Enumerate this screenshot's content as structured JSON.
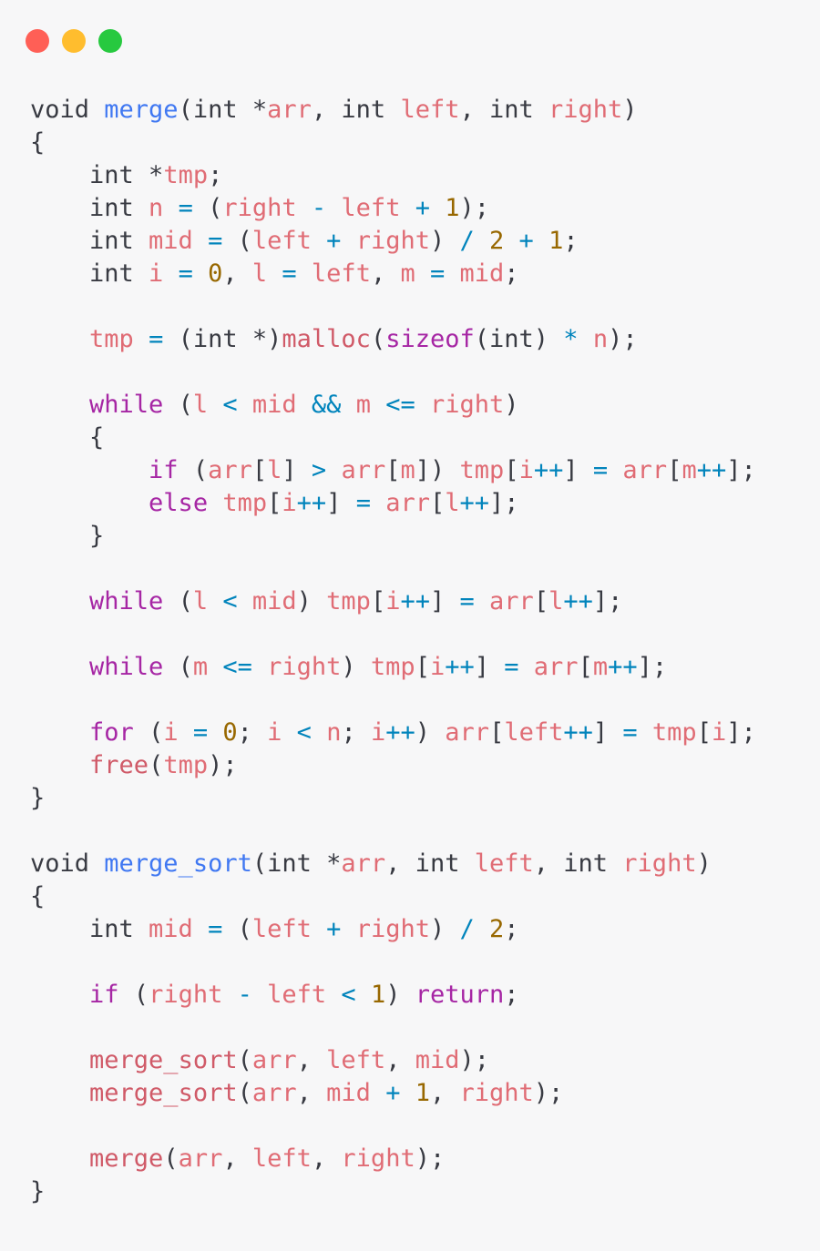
{
  "window_controls": {
    "close_color": "#ff5f56",
    "minimize_color": "#ffbd2e",
    "maximize_color": "#27c93f"
  },
  "code": {
    "language": "c",
    "colors": {
      "plain": "#383a42",
      "function_name": "#4078f2",
      "variable": "#e06c75",
      "number": "#986801",
      "operator": "#0184bc",
      "keyword": "#a626a4"
    },
    "lines": [
      [
        [
          "t",
          "void "
        ],
        [
          "f",
          "merge"
        ],
        [
          "t",
          "(int *"
        ],
        [
          "v",
          "arr"
        ],
        [
          "t",
          ", int "
        ],
        [
          "v",
          "left"
        ],
        [
          "t",
          ", int "
        ],
        [
          "v",
          "right"
        ],
        [
          "t",
          ")"
        ]
      ],
      [
        [
          "t",
          "{"
        ]
      ],
      [
        [
          "t",
          "    int *"
        ],
        [
          "v",
          "tmp"
        ],
        [
          "t",
          ";"
        ]
      ],
      [
        [
          "t",
          "    int "
        ],
        [
          "v",
          "n"
        ],
        [
          "o",
          " = "
        ],
        [
          "t",
          "("
        ],
        [
          "v",
          "right"
        ],
        [
          "o",
          " - "
        ],
        [
          "v",
          "left"
        ],
        [
          "o",
          " + "
        ],
        [
          "n",
          "1"
        ],
        [
          "t",
          ");"
        ]
      ],
      [
        [
          "t",
          "    int "
        ],
        [
          "v",
          "mid"
        ],
        [
          "o",
          " = "
        ],
        [
          "t",
          "("
        ],
        [
          "v",
          "left"
        ],
        [
          "o",
          " + "
        ],
        [
          "v",
          "right"
        ],
        [
          "t",
          ")"
        ],
        [
          "o",
          " / "
        ],
        [
          "n",
          "2"
        ],
        [
          "o",
          " + "
        ],
        [
          "n",
          "1"
        ],
        [
          "t",
          ";"
        ]
      ],
      [
        [
          "t",
          "    int "
        ],
        [
          "v",
          "i"
        ],
        [
          "o",
          " = "
        ],
        [
          "n",
          "0"
        ],
        [
          "t",
          ", "
        ],
        [
          "v",
          "l"
        ],
        [
          "o",
          " = "
        ],
        [
          "v",
          "left"
        ],
        [
          "t",
          ", "
        ],
        [
          "v",
          "m"
        ],
        [
          "o",
          " = "
        ],
        [
          "v",
          "mid"
        ],
        [
          "t",
          ";"
        ]
      ],
      [],
      [
        [
          "t",
          "    "
        ],
        [
          "v",
          "tmp"
        ],
        [
          "o",
          " = "
        ],
        [
          "t",
          "(int *)"
        ],
        [
          "c",
          "malloc"
        ],
        [
          "t",
          "("
        ],
        [
          "k",
          "sizeof"
        ],
        [
          "t",
          "(int)"
        ],
        [
          "o",
          " * "
        ],
        [
          "v",
          "n"
        ],
        [
          "t",
          ");"
        ]
      ],
      [],
      [
        [
          "t",
          "    "
        ],
        [
          "k",
          "while"
        ],
        [
          "t",
          " ("
        ],
        [
          "v",
          "l"
        ],
        [
          "o",
          " < "
        ],
        [
          "v",
          "mid"
        ],
        [
          "o",
          " && "
        ],
        [
          "v",
          "m"
        ],
        [
          "o",
          " <= "
        ],
        [
          "v",
          "right"
        ],
        [
          "t",
          ")"
        ]
      ],
      [
        [
          "t",
          "    {"
        ]
      ],
      [
        [
          "t",
          "        "
        ],
        [
          "k",
          "if"
        ],
        [
          "t",
          " ("
        ],
        [
          "v",
          "arr"
        ],
        [
          "t",
          "["
        ],
        [
          "v",
          "l"
        ],
        [
          "t",
          "]"
        ],
        [
          "o",
          " > "
        ],
        [
          "v",
          "arr"
        ],
        [
          "t",
          "["
        ],
        [
          "v",
          "m"
        ],
        [
          "t",
          "]) "
        ],
        [
          "v",
          "tmp"
        ],
        [
          "t",
          "["
        ],
        [
          "v",
          "i"
        ],
        [
          "o",
          "++"
        ],
        [
          "t",
          "]"
        ],
        [
          "o",
          " = "
        ],
        [
          "v",
          "arr"
        ],
        [
          "t",
          "["
        ],
        [
          "v",
          "m"
        ],
        [
          "o",
          "++"
        ],
        [
          "t",
          "];"
        ]
      ],
      [
        [
          "t",
          "        "
        ],
        [
          "k",
          "else"
        ],
        [
          "t",
          " "
        ],
        [
          "v",
          "tmp"
        ],
        [
          "t",
          "["
        ],
        [
          "v",
          "i"
        ],
        [
          "o",
          "++"
        ],
        [
          "t",
          "]"
        ],
        [
          "o",
          " = "
        ],
        [
          "v",
          "arr"
        ],
        [
          "t",
          "["
        ],
        [
          "v",
          "l"
        ],
        [
          "o",
          "++"
        ],
        [
          "t",
          "];"
        ]
      ],
      [
        [
          "t",
          "    }"
        ]
      ],
      [],
      [
        [
          "t",
          "    "
        ],
        [
          "k",
          "while"
        ],
        [
          "t",
          " ("
        ],
        [
          "v",
          "l"
        ],
        [
          "o",
          " < "
        ],
        [
          "v",
          "mid"
        ],
        [
          "t",
          ") "
        ],
        [
          "v",
          "tmp"
        ],
        [
          "t",
          "["
        ],
        [
          "v",
          "i"
        ],
        [
          "o",
          "++"
        ],
        [
          "t",
          "]"
        ],
        [
          "o",
          " = "
        ],
        [
          "v",
          "arr"
        ],
        [
          "t",
          "["
        ],
        [
          "v",
          "l"
        ],
        [
          "o",
          "++"
        ],
        [
          "t",
          "];"
        ]
      ],
      [],
      [
        [
          "t",
          "    "
        ],
        [
          "k",
          "while"
        ],
        [
          "t",
          " ("
        ],
        [
          "v",
          "m"
        ],
        [
          "o",
          " <= "
        ],
        [
          "v",
          "right"
        ],
        [
          "t",
          ") "
        ],
        [
          "v",
          "tmp"
        ],
        [
          "t",
          "["
        ],
        [
          "v",
          "i"
        ],
        [
          "o",
          "++"
        ],
        [
          "t",
          "]"
        ],
        [
          "o",
          " = "
        ],
        [
          "v",
          "arr"
        ],
        [
          "t",
          "["
        ],
        [
          "v",
          "m"
        ],
        [
          "o",
          "++"
        ],
        [
          "t",
          "];"
        ]
      ],
      [],
      [
        [
          "t",
          "    "
        ],
        [
          "k",
          "for"
        ],
        [
          "t",
          " ("
        ],
        [
          "v",
          "i"
        ],
        [
          "o",
          " = "
        ],
        [
          "n",
          "0"
        ],
        [
          "t",
          "; "
        ],
        [
          "v",
          "i"
        ],
        [
          "o",
          " < "
        ],
        [
          "v",
          "n"
        ],
        [
          "t",
          "; "
        ],
        [
          "v",
          "i"
        ],
        [
          "o",
          "++"
        ],
        [
          "t",
          ") "
        ],
        [
          "v",
          "arr"
        ],
        [
          "t",
          "["
        ],
        [
          "v",
          "left"
        ],
        [
          "o",
          "++"
        ],
        [
          "t",
          "]"
        ],
        [
          "o",
          " = "
        ],
        [
          "v",
          "tmp"
        ],
        [
          "t",
          "["
        ],
        [
          "v",
          "i"
        ],
        [
          "t",
          "];"
        ]
      ],
      [
        [
          "t",
          "    "
        ],
        [
          "c",
          "free"
        ],
        [
          "t",
          "("
        ],
        [
          "v",
          "tmp"
        ],
        [
          "t",
          ");"
        ]
      ],
      [
        [
          "t",
          "}"
        ]
      ],
      [],
      [
        [
          "t",
          "void "
        ],
        [
          "f",
          "merge_sort"
        ],
        [
          "t",
          "(int *"
        ],
        [
          "v",
          "arr"
        ],
        [
          "t",
          ", int "
        ],
        [
          "v",
          "left"
        ],
        [
          "t",
          ", int "
        ],
        [
          "v",
          "right"
        ],
        [
          "t",
          ")"
        ]
      ],
      [
        [
          "t",
          "{"
        ]
      ],
      [
        [
          "t",
          "    int "
        ],
        [
          "v",
          "mid"
        ],
        [
          "o",
          " = "
        ],
        [
          "t",
          "("
        ],
        [
          "v",
          "left"
        ],
        [
          "o",
          " + "
        ],
        [
          "v",
          "right"
        ],
        [
          "t",
          ")"
        ],
        [
          "o",
          " / "
        ],
        [
          "n",
          "2"
        ],
        [
          "t",
          ";"
        ]
      ],
      [],
      [
        [
          "t",
          "    "
        ],
        [
          "k",
          "if"
        ],
        [
          "t",
          " ("
        ],
        [
          "v",
          "right"
        ],
        [
          "o",
          " - "
        ],
        [
          "v",
          "left"
        ],
        [
          "o",
          " < "
        ],
        [
          "n",
          "1"
        ],
        [
          "t",
          ") "
        ],
        [
          "k",
          "return"
        ],
        [
          "t",
          ";"
        ]
      ],
      [],
      [
        [
          "t",
          "    "
        ],
        [
          "c",
          "merge_sort"
        ],
        [
          "t",
          "("
        ],
        [
          "v",
          "arr"
        ],
        [
          "t",
          ", "
        ],
        [
          "v",
          "left"
        ],
        [
          "t",
          ", "
        ],
        [
          "v",
          "mid"
        ],
        [
          "t",
          ");"
        ]
      ],
      [
        [
          "t",
          "    "
        ],
        [
          "c",
          "merge_sort"
        ],
        [
          "t",
          "("
        ],
        [
          "v",
          "arr"
        ],
        [
          "t",
          ", "
        ],
        [
          "v",
          "mid"
        ],
        [
          "o",
          " + "
        ],
        [
          "n",
          "1"
        ],
        [
          "t",
          ", "
        ],
        [
          "v",
          "right"
        ],
        [
          "t",
          ");"
        ]
      ],
      [],
      [
        [
          "t",
          "    "
        ],
        [
          "c",
          "merge"
        ],
        [
          "t",
          "("
        ],
        [
          "v",
          "arr"
        ],
        [
          "t",
          ", "
        ],
        [
          "v",
          "left"
        ],
        [
          "t",
          ", "
        ],
        [
          "v",
          "right"
        ],
        [
          "t",
          ");"
        ]
      ],
      [
        [
          "t",
          "}"
        ]
      ]
    ]
  }
}
